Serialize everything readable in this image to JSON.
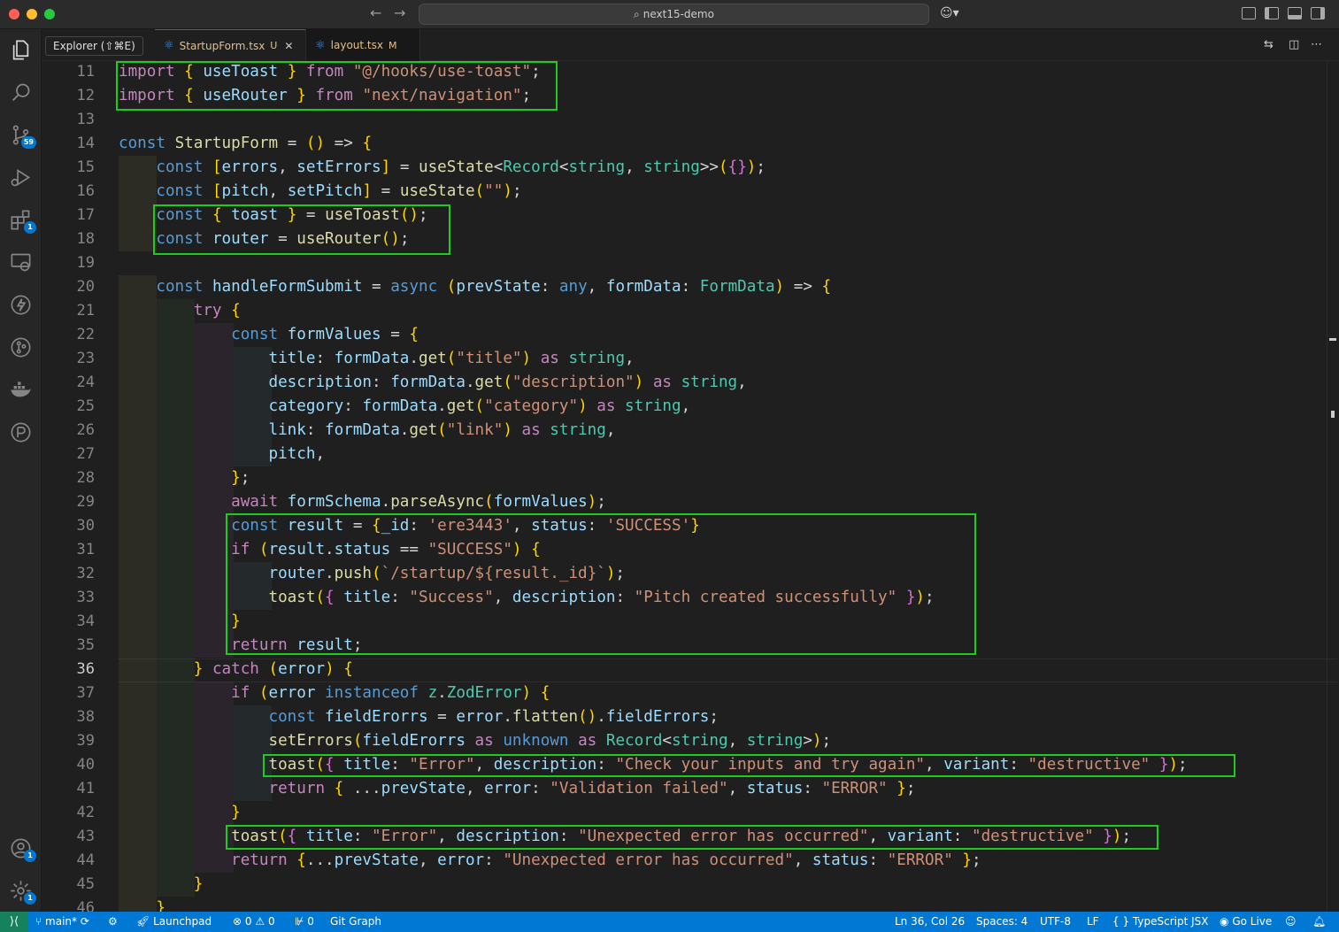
{
  "window": {
    "search_text": "next15-demo"
  },
  "tooltip": "Explorer (⇧⌘E)",
  "tabs": [
    {
      "label": "StartupForm.tsx",
      "status": "U",
      "active": true
    },
    {
      "label": "layout.tsx",
      "status": "M",
      "active": false
    }
  ],
  "activity_bar": {
    "items": [
      {
        "icon": "files-icon"
      },
      {
        "icon": "search-icon"
      },
      {
        "icon": "source-control-icon",
        "badge": "59"
      },
      {
        "icon": "run-debug-icon"
      },
      {
        "icon": "extensions-icon",
        "badge": "1"
      },
      {
        "icon": "remote-explorer-icon"
      },
      {
        "icon": "lightning-icon"
      },
      {
        "icon": "git-graph-icon"
      },
      {
        "icon": "docker-icon"
      },
      {
        "icon": "timeline-icon"
      }
    ],
    "bottom": [
      {
        "icon": "account-icon",
        "badge": "1"
      },
      {
        "icon": "settings-gear-icon",
        "badge": "1"
      }
    ]
  },
  "editor": {
    "current_line": 36,
    "line_numbers": [
      "11",
      "12",
      "13",
      "14",
      "15",
      "16",
      "17",
      "18",
      "19",
      "20",
      "21",
      "22",
      "23",
      "24",
      "25",
      "26",
      "27",
      "28",
      "29",
      "30",
      "31",
      "32",
      "33",
      "34",
      "35",
      "36",
      "37",
      "38",
      "39",
      "40",
      "41",
      "42",
      "43",
      "44",
      "45",
      "46"
    ],
    "lines": [
      "import { useToast } from \"@/hooks/use-toast\";",
      "import { useRouter } from \"next/navigation\";",
      "",
      "const StartupForm = () => {",
      "    const [errors, setErrors] = useState<Record<string, string>>({});",
      "    const [pitch, setPitch] = useState(\"\");",
      "    const { toast } = useToast();",
      "    const router = useRouter();",
      "",
      "    const handleFormSubmit = async (prevState: any, formData: FormData) => {",
      "        try {",
      "            const formValues = {",
      "                title: formData.get(\"title\") as string,",
      "                description: formData.get(\"description\") as string,",
      "                category: formData.get(\"category\") as string,",
      "                link: formData.get(\"link\") as string,",
      "                pitch,",
      "            };",
      "            await formSchema.parseAsync(formValues);",
      "            const result = {_id: 'ere3443', status: 'SUCCESS'}",
      "            if (result.status == \"SUCCESS\") {",
      "                router.push(`/startup/${result._id}`);",
      "                toast({ title: \"Success\", description: \"Pitch created successfully\" });",
      "            }",
      "            return result;",
      "        } catch (error) {",
      "            if (error instanceof z.ZodError) {",
      "                const fieldErorrs = error.flatten().fieldErrors;",
      "                setErrors(fieldErorrs as unknown as Record<string, string>);",
      "                toast({ title: \"Error\", description: \"Check your inputs and try again\", variant: \"destructive\" });",
      "                return { ...prevState, error: \"Validation failed\", status: \"ERROR\" };",
      "            }",
      "            toast({ title: \"Error\", description: \"Unexpected error has occurred\", variant: \"destructive\" });",
      "            return {...prevState, error: \"Unexpected error has occurred\", status: \"ERROR\" };",
      "        }",
      "    }"
    ]
  },
  "status_bar": {
    "branch": "main*",
    "launchpad": "Launchpad",
    "errors": "0",
    "warnings": "0",
    "ports": "0",
    "git_graph": "Git Graph",
    "cursor": "Ln 36, Col 26",
    "spaces": "Spaces: 4",
    "encoding": "UTF-8",
    "eol": "LF",
    "language": "TypeScript JSX",
    "go_live": "Go Live"
  },
  "colors": {
    "accent": "#0078d4",
    "highlight_box": "#1ecb1e",
    "modified_tab": "#e2c08d"
  }
}
